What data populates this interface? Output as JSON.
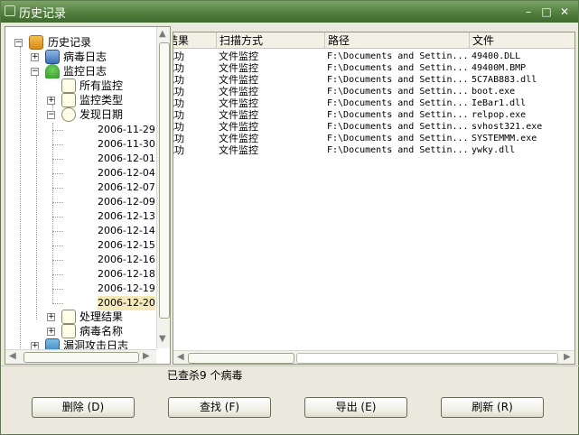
{
  "window": {
    "title": "历史记录",
    "min": "–",
    "max": "□",
    "close": "✕"
  },
  "tree": {
    "root": "历史记录",
    "virus_log": "病毒日志",
    "monitor_log": "监控日志",
    "all_monitor": "所有监控",
    "monitor_type": "监控类型",
    "found_date": "发现日期",
    "dates": [
      "2006-11-29",
      "2006-11-30",
      "2006-12-01",
      "2006-12-04",
      "2006-12-07",
      "2006-12-09",
      "2006-12-13",
      "2006-12-14",
      "2006-12-15",
      "2006-12-16",
      "2006-12-18",
      "2006-12-19",
      "2006-12-20"
    ],
    "selected_date": "2006-12-20",
    "result": "处理结果",
    "virus_name": "病毒名称",
    "vuln_log": "漏洞攻击日志"
  },
  "list": {
    "columns": [
      "结果",
      "扫描方式",
      "路径",
      "文件"
    ],
    "rows": [
      [
        "成功",
        "文件监控",
        "F:\\Documents and Settin...",
        "49400.DLL"
      ],
      [
        "成功",
        "文件监控",
        "F:\\Documents and Settin...",
        "49400M.BMP"
      ],
      [
        "成功",
        "文件监控",
        "F:\\Documents and Settin...",
        "5C7AB883.dll"
      ],
      [
        "成功",
        "文件监控",
        "F:\\Documents and Settin...",
        "boot.exe"
      ],
      [
        "成功",
        "文件监控",
        "F:\\Documents and Settin...",
        "IeBar1.dll"
      ],
      [
        "成功",
        "文件监控",
        "F:\\Documents and Settin...",
        "relpop.exe"
      ],
      [
        "成功",
        "文件监控",
        "F:\\Documents and Settin...",
        "svhost321.exe"
      ],
      [
        "成功",
        "文件监控",
        "F:\\Documents and Settin...",
        "SYSTEMMM.exe"
      ],
      [
        "成功",
        "文件监控",
        "F:\\Documents and Settin...",
        "ywky.dll"
      ]
    ]
  },
  "status_text": "已查杀9 个病毒",
  "buttons": {
    "delete": "删除 (D)",
    "find": "查找 (F)",
    "export": "导出 (E)",
    "refresh": "刷新 (R)"
  }
}
